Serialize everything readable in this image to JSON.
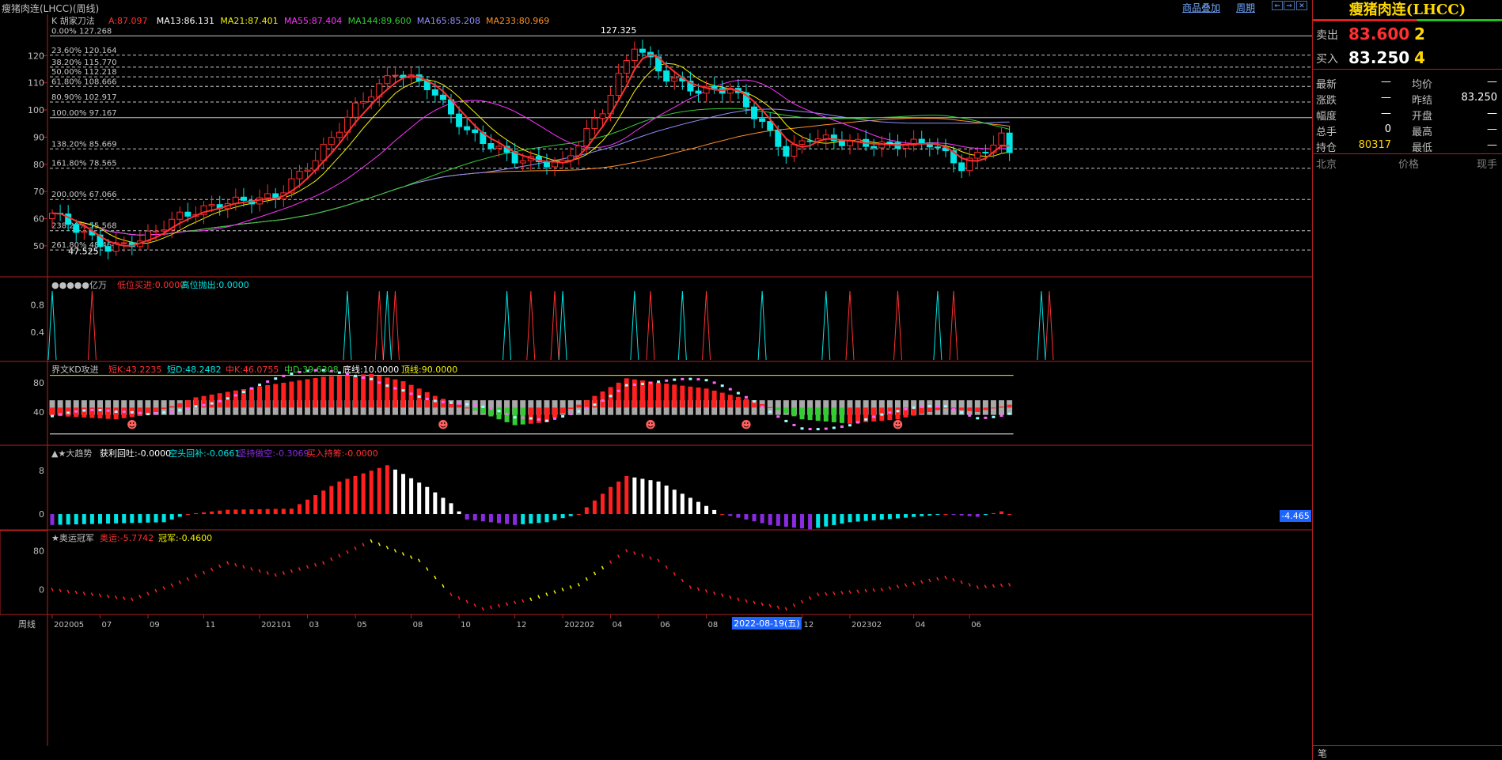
{
  "window": {
    "title": "瘦猪肉连(LHCC)(周线)",
    "links": [
      "商品叠加",
      "周期"
    ]
  },
  "colors": {
    "up": "#ff2a2a",
    "down": "#00e5e5",
    "grid": "#b02020",
    "ma13": "#ffffff",
    "ma21": "#f2f200",
    "ma55": "#ff33ff",
    "ma144": "#33cc33",
    "ma165": "#8f8fff",
    "ma233": "#ff8f26"
  },
  "chart_data": [
    {
      "type": "candlestick",
      "title": "K 胡家刀法",
      "legend": [
        {
          "label": "A:87.097",
          "color": "#ff3030"
        },
        {
          "label": "MA13:86.131",
          "color": "#ffffff"
        },
        {
          "label": "MA21:87.401",
          "color": "#f2f200"
        },
        {
          "label": "MA55:87.404",
          "color": "#ff33ff"
        },
        {
          "label": "MA144:89.600",
          "color": "#33cc33"
        },
        {
          "label": "MA165:85.208",
          "color": "#8f8fff"
        },
        {
          "label": "MA233:80.969",
          "color": "#ff8f26"
        }
      ],
      "yticks": [
        50,
        60,
        70,
        80,
        90,
        100,
        110,
        120
      ],
      "ylim": [
        45,
        130
      ],
      "fib_levels": [
        {
          "label": "0.00% 127.268",
          "value": 127.268
        },
        {
          "label": "23.60% 120.164",
          "value": 120.164
        },
        {
          "label": "38.20% 115.770",
          "value": 115.77
        },
        {
          "label": "50.00% 112.218",
          "value": 112.218
        },
        {
          "label": "61.80% 108.666",
          "value": 108.666
        },
        {
          "label": "80.90% 102.917",
          "value": 102.917
        },
        {
          "label": "100.00% 97.167",
          "value": 97.167
        },
        {
          "label": "138.20% 85.669",
          "value": 85.669
        },
        {
          "label": "161.80% 78.565",
          "value": 78.565
        },
        {
          "label": "200.00% 67.066",
          "value": 67.066
        },
        {
          "label": "238.20% 55.568",
          "value": 55.568
        },
        {
          "label": "261.80% 48.464",
          "value": 48.464
        }
      ],
      "annotations": [
        {
          "text": "127.325",
          "value": 127.325
        },
        {
          "text": "47.525",
          "value": 47.525
        }
      ],
      "last_close": 84.0
    },
    {
      "type": "spike",
      "title": "●●●●●亿万",
      "legend": [
        {
          "label": "低位买进:0.0000",
          "color": "#ff3030"
        },
        {
          "label": "高位抛出:0.0000",
          "color": "#00e5e5"
        }
      ],
      "yticks": [
        0.4,
        0.8
      ],
      "ylim": [
        0,
        1
      ],
      "spikes_red_index": [
        5,
        41,
        43,
        60,
        63,
        75,
        82,
        100,
        106,
        113,
        125
      ],
      "spikes_cyan_index": [
        0,
        37,
        42,
        57,
        64,
        73,
        79,
        89,
        97,
        111,
        124
      ]
    },
    {
      "type": "bar",
      "title": "界文KD攻进",
      "legend": [
        {
          "label": "短K:43.2235",
          "color": "#ff3030"
        },
        {
          "label": "短D:48.2482",
          "color": "#00e5e5"
        },
        {
          "label": "中K:46.0755",
          "color": "#ff3030"
        },
        {
          "label": "中D:39.6308",
          "color": "#33cc33"
        },
        {
          "label": "底线:10.0000",
          "color": "#ffffff"
        },
        {
          "label": "顶线:90.0000",
          "color": "#f2f200"
        }
      ],
      "yticks": [
        40,
        80
      ],
      "ylim": [
        0,
        100
      ],
      "last_value": 43.22
    },
    {
      "type": "bar",
      "title": "▲★大趋势",
      "legend": [
        {
          "label": "获利回吐:-0.0000",
          "color": "#ffffff"
        },
        {
          "label": "空头回补:-0.0661",
          "color": "#00e5e5"
        },
        {
          "label": "坚持做空:-0.3069",
          "color": "#8a2be2"
        },
        {
          "label": "买入持筹:-0.0000",
          "color": "#ff3030"
        }
      ],
      "yticks": [
        0,
        8
      ],
      "ylim": [
        -3.2,
        10.5
      ],
      "value_box": "-4.465"
    },
    {
      "type": "scatter",
      "title": "★奥运冠军",
      "legend": [
        {
          "label": "奥运:-5.7742",
          "color": "#ff3030"
        },
        {
          "label": "冠军:-0.4600",
          "color": "#f2f200"
        }
      ],
      "yticks": [
        0,
        80
      ],
      "ylim": [
        -40,
        110
      ]
    }
  ],
  "xaxis": {
    "period_label": "周线",
    "ticks": [
      {
        "label": "202005",
        "index": 0
      },
      {
        "label": "07",
        "index": 6
      },
      {
        "label": "09",
        "index": 12
      },
      {
        "label": "11",
        "index": 19
      },
      {
        "label": "202101",
        "index": 26
      },
      {
        "label": "03",
        "index": 32
      },
      {
        "label": "05",
        "index": 38
      },
      {
        "label": "08",
        "index": 45
      },
      {
        "label": "10",
        "index": 51
      },
      {
        "label": "12",
        "index": 58
      },
      {
        "label": "202202",
        "index": 64
      },
      {
        "label": "04",
        "index": 70
      },
      {
        "label": "06",
        "index": 76
      },
      {
        "label": "08",
        "index": 82
      },
      {
        "label": "12",
        "index": 94
      },
      {
        "label": "202302",
        "index": 100
      },
      {
        "label": "04",
        "index": 108
      },
      {
        "label": "06",
        "index": 115
      }
    ],
    "cursor_label": "2022-08-19(五)",
    "cursor_index": 86
  },
  "sidebar": {
    "title": "瘦猪肉连(LHCC)",
    "sell_label": "卖出",
    "sell_price": "83.600",
    "sell_vol": "2",
    "buy_label": "买入",
    "buy_price": "83.250",
    "buy_vol": "4",
    "stats": [
      {
        "l1": "最新",
        "v1": "—",
        "l2": "均价",
        "v2": "—"
      },
      {
        "l1": "涨跌",
        "v1": "—",
        "l2": "昨结",
        "v2": "83.250"
      },
      {
        "l1": "幅度",
        "v1": "—",
        "l2": "开盘",
        "v2": "—"
      },
      {
        "l1": "总手",
        "v1": "0",
        "l2": "最高",
        "v2": "—"
      },
      {
        "l1": "持仓",
        "v1": "80317",
        "l2": "最低",
        "v2": "—"
      }
    ],
    "footer": {
      "c1": "北京",
      "c2": "价格",
      "c3": "现手"
    },
    "bottom_label": "笔"
  }
}
